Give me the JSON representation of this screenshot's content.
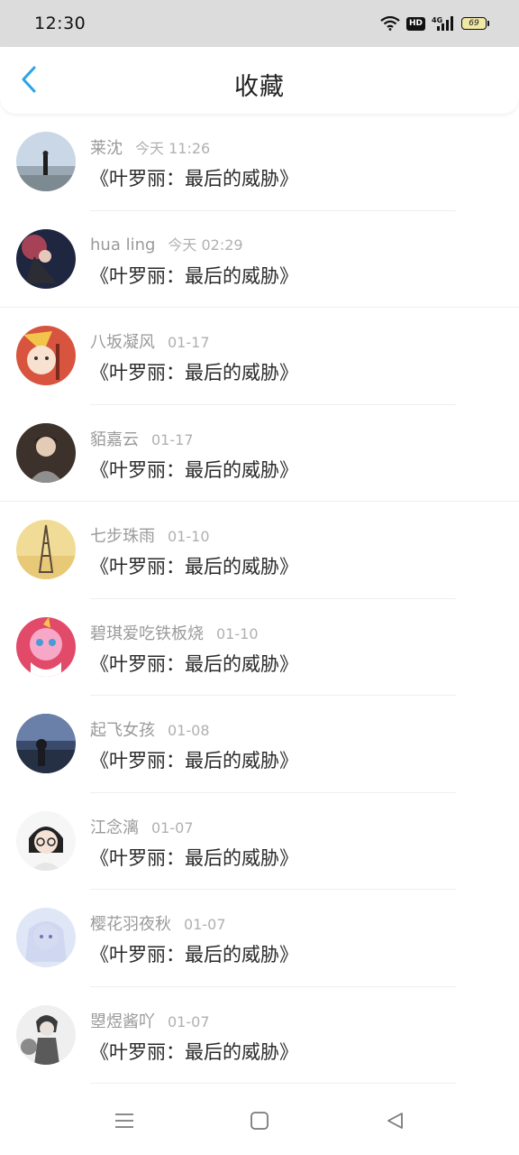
{
  "status_bar": {
    "time": "12:30",
    "hd": "HD",
    "network": "4G",
    "battery": "69"
  },
  "header": {
    "title": "收藏",
    "back_icon": "chevron-left-icon",
    "accent_color": "#2aa4e6"
  },
  "favorites": [
    {
      "user": "莱沈",
      "date": "今天 11:26",
      "title": "《叶罗丽：最后的威胁》"
    },
    {
      "user": "hua ling",
      "date": "今天 02:29",
      "title": "《叶罗丽：最后的威胁》"
    },
    {
      "user": "八坂凝风",
      "date": "01-17",
      "title": "《叶罗丽：最后的威胁》"
    },
    {
      "user": "貊嘉云",
      "date": "01-17",
      "title": "《叶罗丽：最后的威胁》"
    },
    {
      "user": "七步珠雨",
      "date": "01-10",
      "title": "《叶罗丽：最后的威胁》"
    },
    {
      "user": "碧琪爱吃铁板烧",
      "date": "01-10",
      "title": "《叶罗丽：最后的威胁》"
    },
    {
      "user": "起飞女孩",
      "date": "01-08",
      "title": "《叶罗丽：最后的威胁》"
    },
    {
      "user": "江念漓",
      "date": "01-07",
      "title": "《叶罗丽：最后的威胁》"
    },
    {
      "user": "樱花羽夜秋",
      "date": "01-07",
      "title": "《叶罗丽：最后的威胁》"
    },
    {
      "user": "曌煜酱吖",
      "date": "01-07",
      "title": "《叶罗丽：最后的威胁》"
    }
  ],
  "nav_bar": {
    "menu_icon": "menu-icon",
    "home_icon": "home-square-icon",
    "back_icon": "back-triangle-icon"
  }
}
